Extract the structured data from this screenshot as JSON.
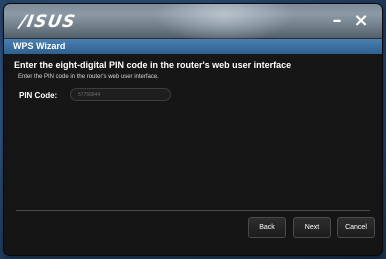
{
  "window": {
    "brand": "/ISUS",
    "minimize_glyph": "–",
    "close_glyph": "×",
    "title": "WPS Wizard"
  },
  "content": {
    "heading": "Enter the eight-digital PIN code in the router's web user interface",
    "instruction": "Enter the PIN code in the router's web user interface.",
    "pin_label": "PIN Code:",
    "pin_value": "57756844"
  },
  "buttons": {
    "back": "Back",
    "next": "Next",
    "cancel": "Cancel"
  },
  "colors": {
    "title_bar": "#7d8b97",
    "wizard_bar": "#3a6f9f",
    "panel": "#161616",
    "desktop": "#284a72"
  }
}
